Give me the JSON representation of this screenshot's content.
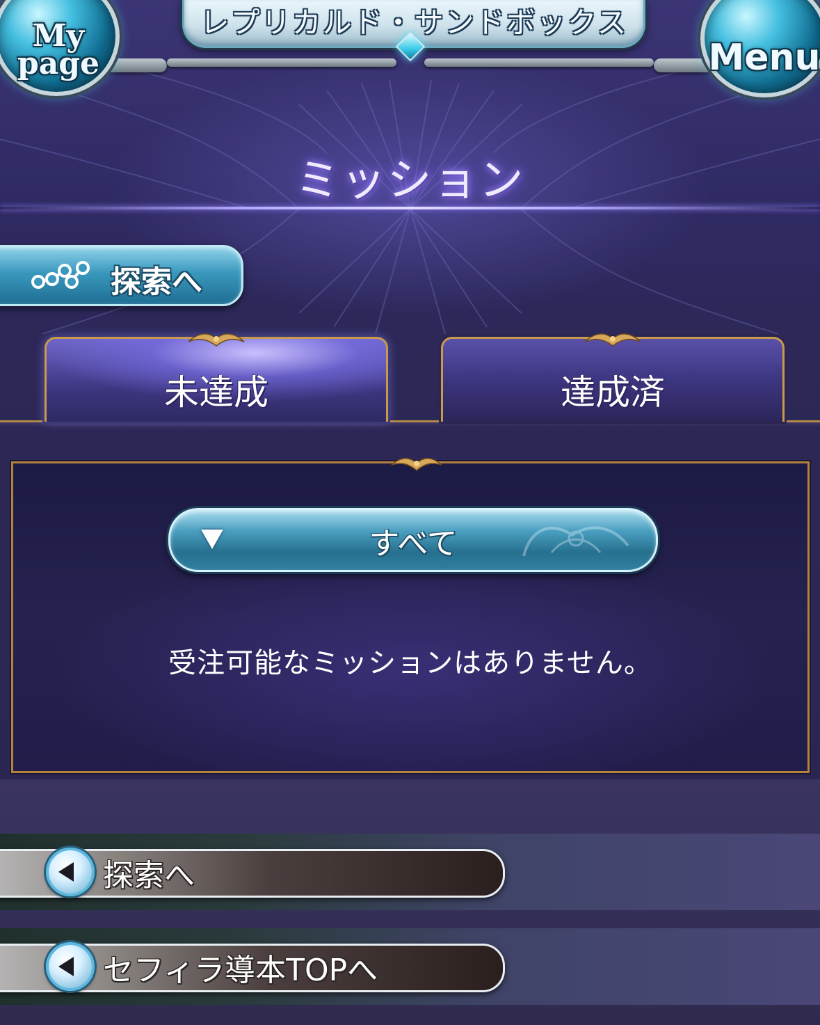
{
  "header": {
    "title": "レプリカルド・サンドボックス",
    "mypage_label": "My page",
    "menu_label": "Menu"
  },
  "page": {
    "title": "ミッション"
  },
  "explore_button": {
    "label": "探索へ",
    "icon": "nodes-icon"
  },
  "tabs": [
    {
      "label": "未達成",
      "active": true
    },
    {
      "label": "達成済",
      "active": false
    }
  ],
  "filter": {
    "selected": "すべて",
    "icon": "dropdown-arrow-icon"
  },
  "missions": {
    "empty_message": "受注可能なミッションはありません。"
  },
  "bottom_nav": [
    {
      "label": "探索へ",
      "icon": "back-arrow-icon"
    },
    {
      "label": "セフィラ導本TOPへ",
      "icon": "back-arrow-icon"
    }
  ],
  "colors": {
    "background": "#2a2547",
    "gold_border": "#c99a4e",
    "accent_blue": "#4a9fc0",
    "title_glow": "#a78bff"
  }
}
